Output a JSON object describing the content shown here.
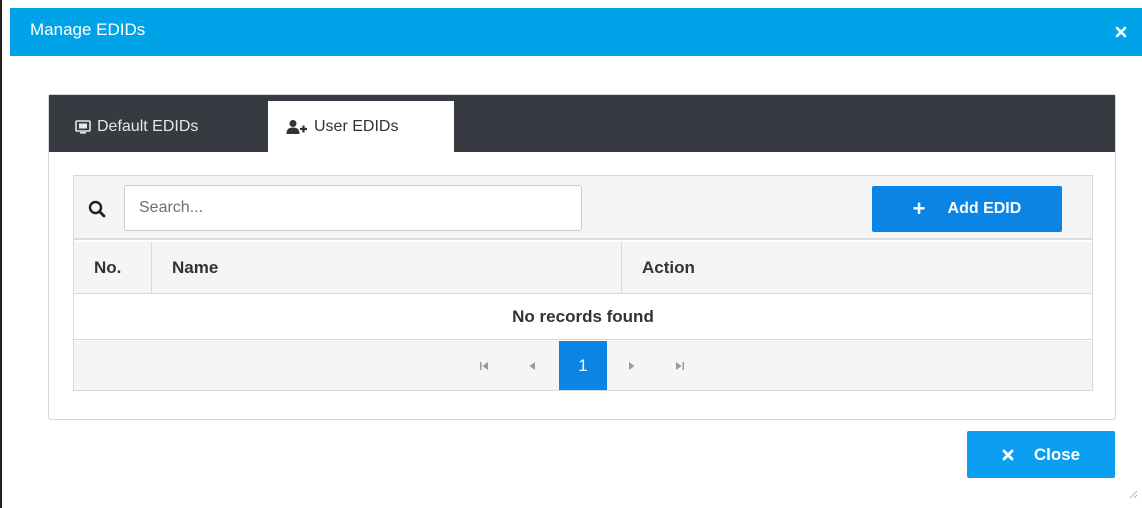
{
  "dialog": {
    "title": "Manage EDIDs"
  },
  "tabs": [
    {
      "label": "Default EDIDs",
      "icon": "monitor-icon",
      "active": false
    },
    {
      "label": "User EDIDs",
      "icon": "add-user-icon",
      "active": true
    }
  ],
  "toolbar": {
    "search_placeholder": "Search...",
    "search_value": "",
    "add_label": "Add EDID"
  },
  "table": {
    "columns": [
      "No.",
      "Name",
      "Action"
    ],
    "empty_message": "No records found"
  },
  "pager": {
    "current_page": "1",
    "first": "⏮",
    "prev": "◀",
    "next": "▶",
    "last": "⏭"
  },
  "footer": {
    "close_label": "Close"
  },
  "colors": {
    "titlebar": "#00a3e8",
    "tabbar": "#373a40",
    "primary_button": "#0a85e6"
  }
}
